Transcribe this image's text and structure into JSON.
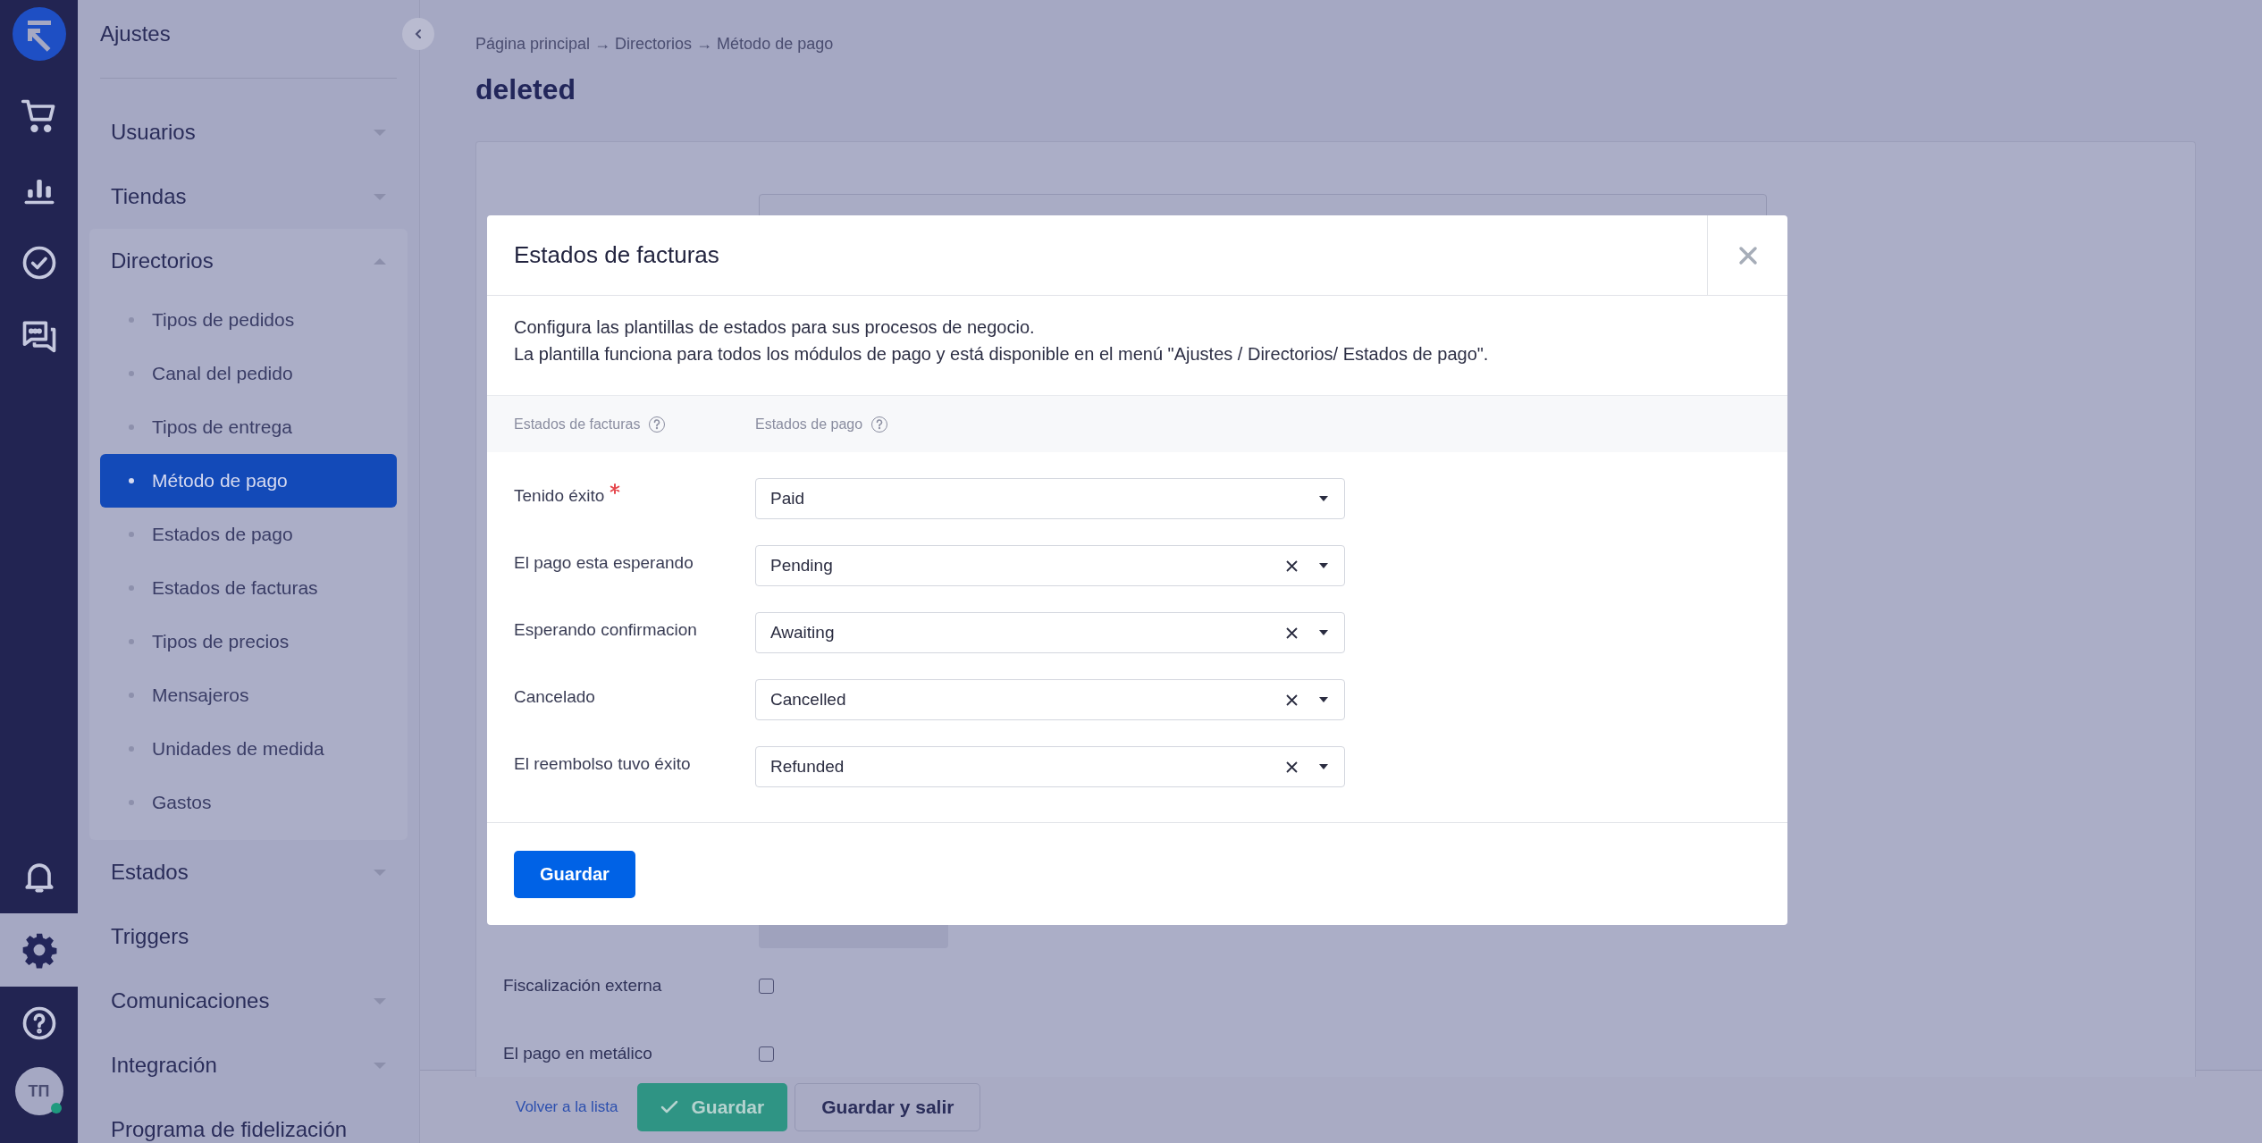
{
  "rail": {
    "top": [
      {
        "selected": false
      },
      {
        "selected": false
      },
      {
        "selected": false
      },
      {
        "selected": false
      }
    ],
    "bottom": [
      {
        "selected": false
      },
      {
        "selected": true
      },
      {
        "selected": false
      }
    ],
    "avatar": {
      "initials": "ТП",
      "online": true
    }
  },
  "sidebar": {
    "title": "Ajustes",
    "sections": [
      {
        "label": "Usuarios",
        "kind": "group",
        "expanded": false
      },
      {
        "label": "Tiendas",
        "kind": "group",
        "expanded": false
      },
      {
        "label": "Directorios",
        "kind": "group",
        "expanded": true,
        "children": [
          {
            "label": "Tipos de pedidos",
            "selected": false
          },
          {
            "label": "Canal del pedido",
            "selected": false
          },
          {
            "label": "Tipos de entrega",
            "selected": false
          },
          {
            "label": "Método de pago",
            "selected": true
          },
          {
            "label": "Estados de pago",
            "selected": false
          },
          {
            "label": "Estados de facturas",
            "selected": false
          },
          {
            "label": "Tipos de precios",
            "selected": false
          },
          {
            "label": "Mensajeros",
            "selected": false
          },
          {
            "label": "Unidades de medida",
            "selected": false
          },
          {
            "label": "Gastos",
            "selected": false
          }
        ]
      },
      {
        "label": "Estados",
        "kind": "group",
        "expanded": false
      },
      {
        "label": "Triggers",
        "kind": "link"
      },
      {
        "label": "Comunicaciones",
        "kind": "group",
        "expanded": false
      },
      {
        "label": "Integración",
        "kind": "group",
        "expanded": false
      },
      {
        "label": "Programa de fidelización",
        "kind": "link"
      }
    ]
  },
  "page": {
    "breadcrumb": "Página principal → Directorios → Método de pago",
    "title": "deleted",
    "fields": [
      {
        "label": "Fiscalización externa",
        "checked": false
      },
      {
        "label": "El pago en metálico",
        "checked": false
      }
    ]
  },
  "bottom_bar": {
    "back_link": "Volver a la lista",
    "save": "Guardar",
    "save_and_exit": "Guardar y salir"
  },
  "modal": {
    "title": "Estados de facturas",
    "description": [
      "Configura las plantillas de estados para sus procesos de negocio.",
      "La plantilla funciona para todos los módulos de pago y está disponible en el menú \"Ajustes / Directorios/ Estados de pago\"."
    ],
    "columns": [
      {
        "label": "Estados de facturas"
      },
      {
        "label": "Estados de pago"
      }
    ],
    "rows": [
      {
        "label": "Tenido éxito",
        "required": true,
        "value": "Paid",
        "clearable": false
      },
      {
        "label": "El pago esta esperando",
        "required": false,
        "value": "Pending",
        "clearable": true
      },
      {
        "label": "Esperando confirmacion",
        "required": false,
        "value": "Awaiting",
        "clearable": true
      },
      {
        "label": "Cancelado",
        "required": false,
        "value": "Cancelled",
        "clearable": true
      },
      {
        "label": "El reembolso tuvo éxito",
        "required": false,
        "value": "Refunded",
        "clearable": true
      }
    ],
    "save": "Guardar"
  }
}
